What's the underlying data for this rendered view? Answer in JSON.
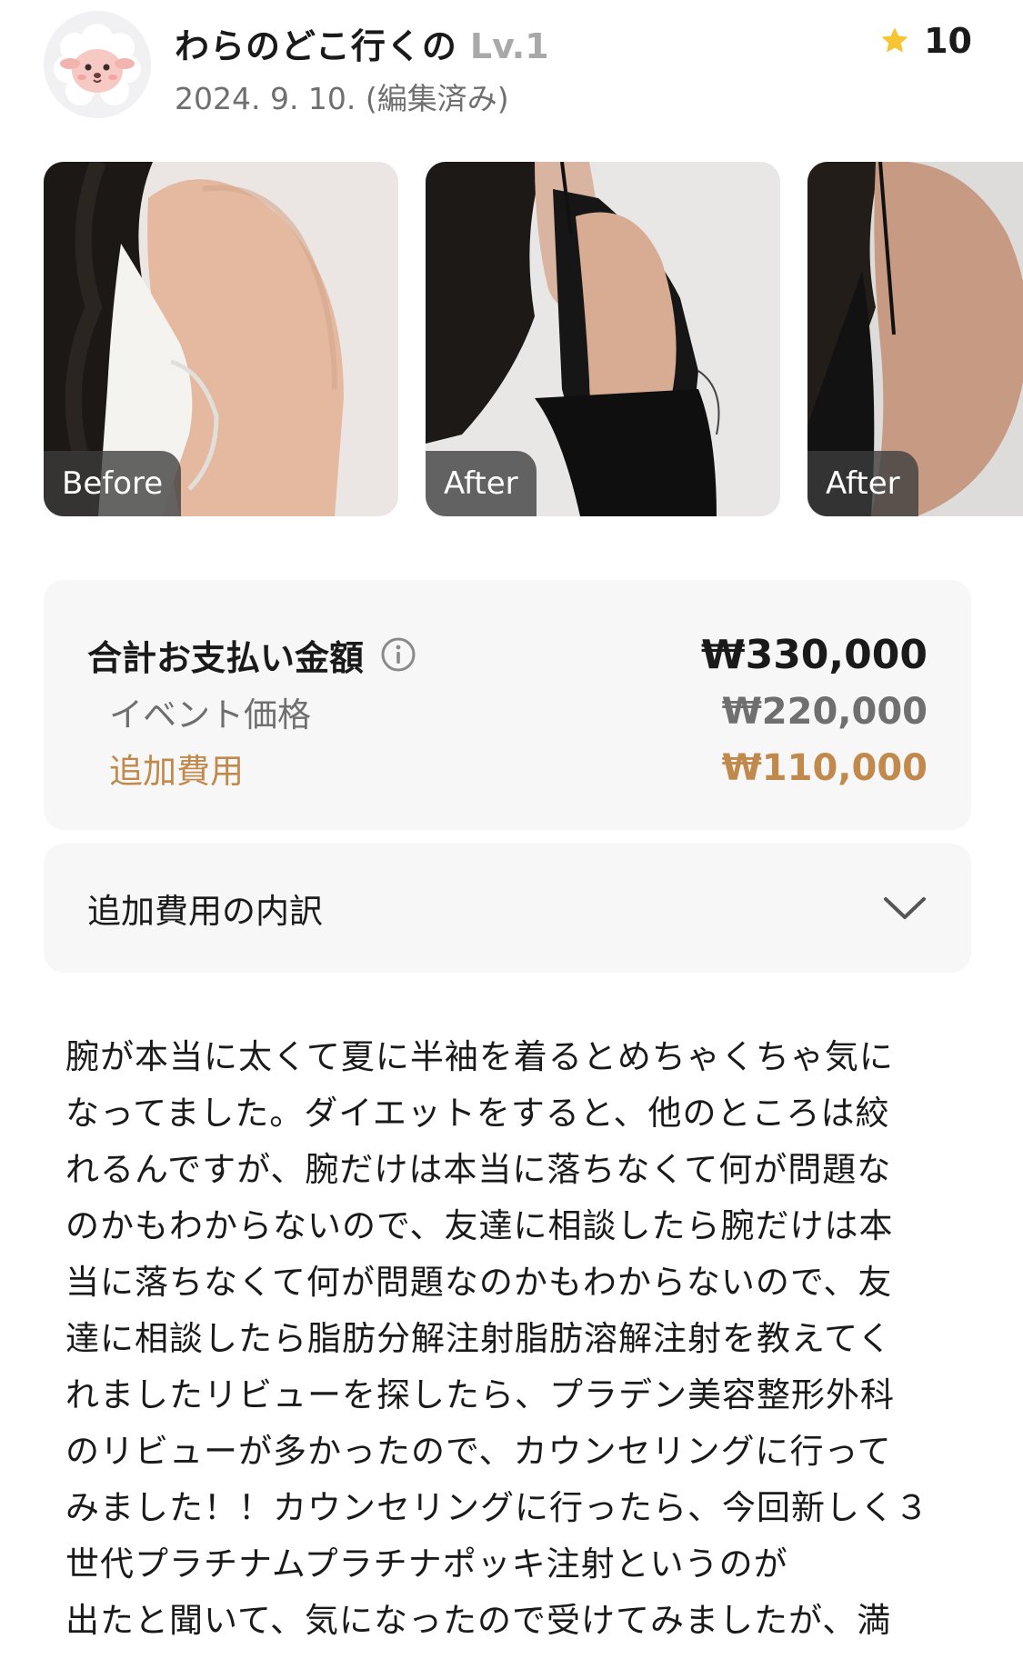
{
  "header": {
    "user_name": "わらのどこ行くの",
    "user_level": "Lv.1",
    "post_date": "2024. 9. 10. (編集済み)",
    "rating_value": "10",
    "rating_icon": "star-icon",
    "star_color": "#f7c533"
  },
  "photos": [
    {
      "tag": "Before"
    },
    {
      "tag": "After"
    },
    {
      "tag": "After"
    }
  ],
  "payment": {
    "total_label": "合計お支払い金額",
    "total_value": "₩330,000",
    "event_label": "イベント価格",
    "event_value": "₩220,000",
    "extra_label": "追加費用",
    "extra_value": "₩110,000",
    "accent_color": "#c2894d",
    "info_icon": "info-icon"
  },
  "breakdown": {
    "label": "追加費用の内訳",
    "icon": "chevron-down-icon"
  },
  "review": {
    "lines": [
      "腕が本当に太くて夏に半袖を着るとめちゃくちゃ気に",
      "なってました。ダイエットをすると、他のところは絞",
      "れるんですが、腕だけは本当に落ちなくて何が問題な",
      "のかもわからないので、友達に相談したら腕だけは本",
      "当に落ちなくて何が問題なのかもわからないので、友",
      "達に相談したら脂肪分解注射脂肪溶解注射を教えてく",
      "れましたリビューを探したら、プラデン美容整形外科",
      "のリビューが多かったので、カウンセリングに行って",
      "みました！！カウンセリングに行ったら、今回新しく３",
      "世代プラチナムプラチナポッキ注射というのが",
      "出たと聞いて、気になったので受けてみましたが、満"
    ]
  }
}
